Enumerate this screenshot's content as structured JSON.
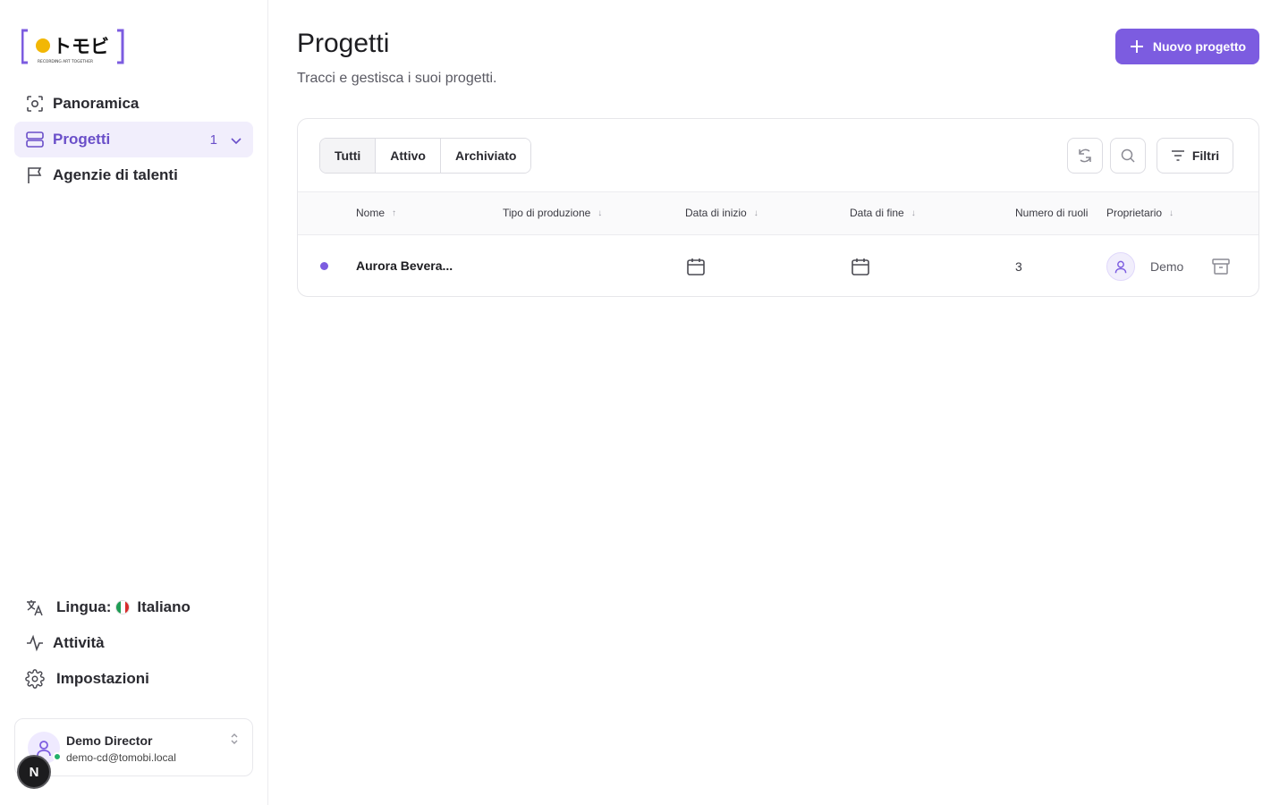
{
  "app": {
    "logo_text": "トモビ",
    "logo_tagline": "RECORDING ART TOGETHER",
    "accent": "#7c5ce0"
  },
  "sidebar": {
    "items": [
      {
        "label": "Panoramica",
        "icon": "scan-icon"
      },
      {
        "label": "Progetti",
        "icon": "projects-icon",
        "count": "1",
        "active": true
      },
      {
        "label": "Agenzie di talenti",
        "icon": "flag-icon"
      }
    ],
    "bottom": {
      "language_label": "Lingua:",
      "language_value": "Italiano",
      "activity_label": "Attività",
      "settings_label": "Impostazioni"
    },
    "user": {
      "name": "Demo Director",
      "email": "demo-cd@tomobi.local",
      "status_color": "#22b06b"
    },
    "badge": "N"
  },
  "main": {
    "title": "Progetti",
    "subtitle": "Tracci e gestisca i suoi progetti.",
    "new_button": "Nuovo progetto",
    "tabs": [
      "Tutti",
      "Attivo",
      "Archiviato"
    ],
    "selected_tab": "Tutti",
    "filters_label": "Filtri",
    "columns": [
      {
        "label": "Nome",
        "sort": "↑"
      },
      {
        "label": "Tipo di produzione",
        "sort": "↓"
      },
      {
        "label": "Data di inizio",
        "sort": "↓"
      },
      {
        "label": "Data di fine",
        "sort": "↓"
      },
      {
        "label": "Numero di ruoli",
        "sort": ""
      },
      {
        "label": "Proprietario",
        "sort": "↓"
      }
    ],
    "rows": [
      {
        "name": "Aurora Bevera...",
        "production_type": "",
        "roles": "3",
        "owner": "Demo"
      }
    ]
  }
}
